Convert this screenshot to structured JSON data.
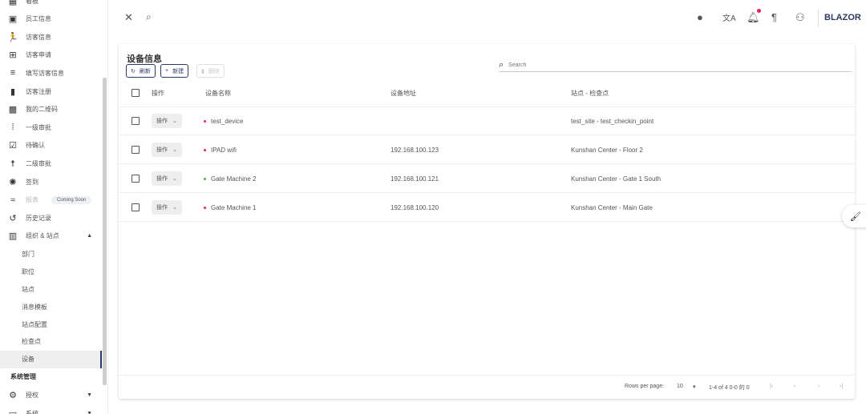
{
  "sidebar": {
    "items": [
      {
        "label": "看板",
        "icon": "dashboard-icon",
        "glyph": "▦"
      },
      {
        "label": "员工信息",
        "icon": "badge-icon",
        "glyph": "▣"
      },
      {
        "label": "访客信息",
        "icon": "walk-icon",
        "glyph": "🏃"
      },
      {
        "label": "访客申请",
        "icon": "post-add-icon",
        "glyph": "⊞"
      },
      {
        "label": "填写访客信息",
        "icon": "edit-note-icon",
        "glyph": "≡"
      },
      {
        "label": "访客注册",
        "icon": "book-icon",
        "glyph": "▮"
      },
      {
        "label": "我的二维码",
        "icon": "qr-code-icon",
        "glyph": "▩"
      },
      {
        "label": "一级审批",
        "icon": "approval-icon",
        "glyph": "⁞"
      },
      {
        "label": "待确认",
        "icon": "fact-check-icon",
        "glyph": "☑"
      },
      {
        "label": "二级审批",
        "icon": "hiking-icon",
        "glyph": "☨"
      },
      {
        "label": "签到",
        "icon": "shutter-icon",
        "glyph": "✺"
      },
      {
        "label": "报表",
        "icon": "chart-icon",
        "glyph": "≈",
        "badge": "Coming Soon"
      },
      {
        "label": "历史记录",
        "icon": "history-icon",
        "glyph": "↺"
      },
      {
        "label": "组织 & 站点",
        "icon": "domain-icon",
        "glyph": "▥"
      }
    ],
    "sub_items": [
      "部门",
      "职位",
      "站点",
      "消息模板",
      "站点配置",
      "检查点",
      "设备"
    ],
    "section": "系统管理",
    "bottom_items": [
      {
        "label": "授权",
        "icon": "manage-accounts-icon",
        "glyph": "⚙"
      },
      {
        "label": "系统",
        "icon": "system-icon",
        "glyph": "▭"
      }
    ]
  },
  "topbar": {
    "brand": "BLAZOR"
  },
  "card": {
    "title": "设备信息",
    "buttons": {
      "refresh": "刷新",
      "new": "新建",
      "delete": "删除"
    },
    "search_placeholder": "Search",
    "columns": [
      "操作",
      "设备名称",
      "设备地址",
      "站点 - 检查点"
    ],
    "rows": [
      {
        "action": "操作",
        "name": "test_device",
        "address": "",
        "site": "test_site - test_checkin_point",
        "status_color": "#e91e63"
      },
      {
        "action": "操作",
        "name": "IPAD wifi",
        "address": "192.168.100.123",
        "site": "Kunshan Center - Floor 2",
        "status_color": "#e91e63"
      },
      {
        "action": "操作",
        "name": "Gate Machine 2",
        "address": "192.168.100.121",
        "site": "Kunshan Center - Gate 1 South",
        "status_color": "#4caf50"
      },
      {
        "action": "操作",
        "name": "Gate Machine 1",
        "address": "192.168.100.120",
        "site": "Kunshan Center - Main Gate",
        "status_color": "#e91e63"
      }
    ],
    "footer": {
      "rows_per_page_label": "Rows per page:",
      "rows_per_page": "10",
      "range": "1-4 of 4 0-0 的 0"
    }
  }
}
